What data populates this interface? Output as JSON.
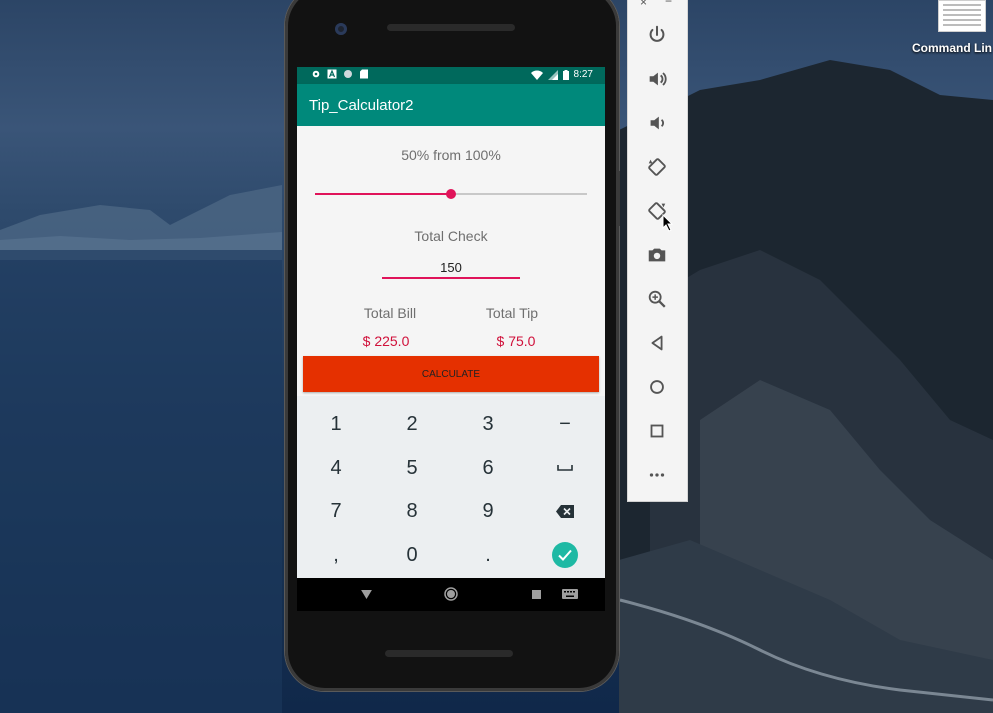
{
  "desktop": {
    "file_label": "Command Lin"
  },
  "emulator_toolbar": {
    "close_glyph": "×",
    "minimize_glyph": "−",
    "buttons": [
      "power-icon",
      "volume-up-icon",
      "volume-down-icon",
      "rotate-left-icon",
      "rotate-right-icon",
      "camera-icon",
      "zoom-icon",
      "back-icon",
      "home-icon",
      "overview-icon",
      "more-icon"
    ]
  },
  "status_bar": {
    "time": "8:27"
  },
  "app": {
    "title": "Tip_Calculator2",
    "percent_label": "50% from 100%",
    "seek_value": 0.5,
    "total_check_label": "Total Check",
    "total_check_value": "150",
    "total_bill_label": "Total Bill",
    "total_bill_value": "$ 225.0",
    "total_tip_label": "Total Tip",
    "total_tip_value": "$ 75.0",
    "calculate_label": "CALCULATE"
  },
  "keypad": {
    "keys": [
      "1",
      "2",
      "3",
      "−",
      "4",
      "5",
      "6",
      "⎵",
      "7",
      "8",
      "9",
      "⌫",
      ",",
      "0",
      ".",
      "✓"
    ]
  },
  "colors": {
    "app_bar": "#00897b",
    "status_bar": "#00695c",
    "accent": "#e0145a",
    "button": "#e53000",
    "value_text": "#d0103a",
    "keypad_bg": "#eceff1",
    "done_key": "#1eb9a4"
  }
}
